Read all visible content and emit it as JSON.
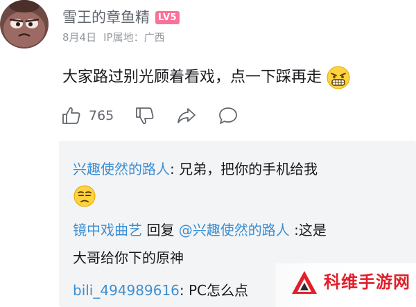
{
  "comment": {
    "username": "雪王的章鱼精",
    "level": "LV5",
    "date": "8月4日",
    "ip_location": "IP属地：广西",
    "text": "大家路过别光顾着看戏，点一下踩再走",
    "text_emoji": "grimace-emoji",
    "likes": "765",
    "action_icons": [
      "thumbs-up-icon",
      "thumbs-down-icon",
      "share-icon",
      "comment-icon"
    ]
  },
  "replies": [
    {
      "author": "兴趣使然的路人",
      "separator": ":",
      "text": " 兄弟，把你的手机给我",
      "emoji": "unamused-emoji"
    },
    {
      "author": "镜中戏曲艺",
      "reply_word": " 回复 ",
      "mention": "@兴趣使然的路人",
      "text_line1": " :这是",
      "text_line2": "大哥给你下的原神"
    },
    {
      "author": "bili_494989616",
      "separator": ":",
      "text": " PC怎么点"
    }
  ],
  "watermark": {
    "text": "科维手游网"
  },
  "colors": {
    "username": "#61666d",
    "meta": "#9499a0",
    "link_blue": "#3d8fd1",
    "badge_pink": "#fb7299",
    "reply_bg": "#f3f4f6",
    "watermark_red": "#e0202a"
  }
}
